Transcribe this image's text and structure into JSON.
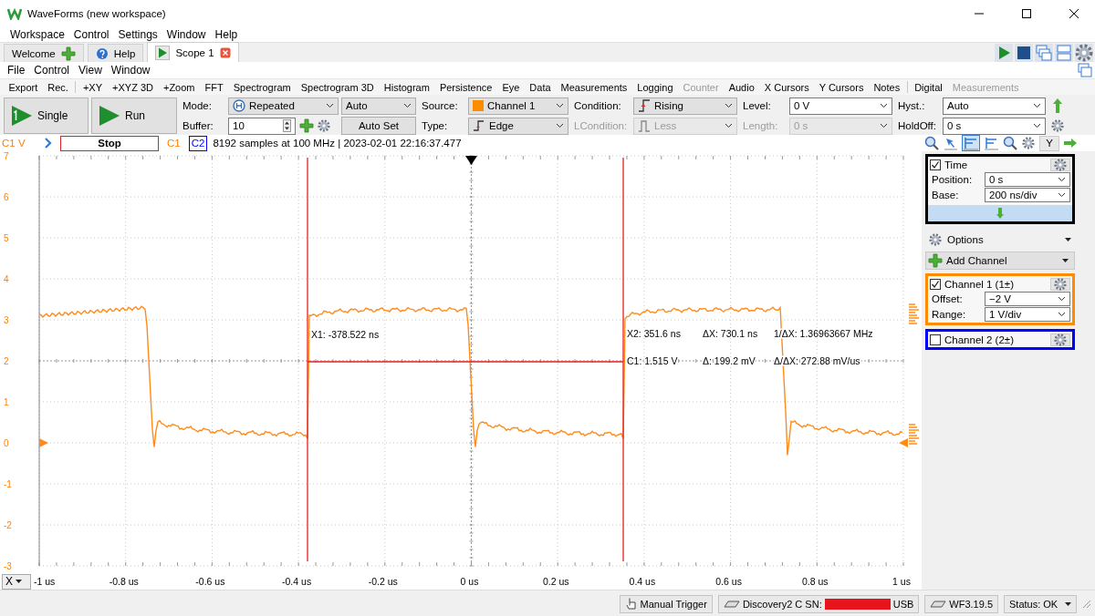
{
  "window": {
    "title": "WaveForms (new workspace)"
  },
  "menu": [
    "Workspace",
    "Control",
    "Settings",
    "Window",
    "Help"
  ],
  "tabs": [
    {
      "label": "Welcome",
      "selected": false
    },
    {
      "label": "Help",
      "selected": false
    },
    {
      "label": "Scope 1",
      "selected": true
    }
  ],
  "scope_menu": [
    "File",
    "Control",
    "View",
    "Window"
  ],
  "toolbar": [
    {
      "label": "Export",
      "disabled": false,
      "divider_before": false
    },
    {
      "label": "Rec.",
      "disabled": false,
      "divider_before": false
    },
    {
      "label": "+XY",
      "disabled": false,
      "divider_before": true
    },
    {
      "label": "+XYZ 3D",
      "disabled": false,
      "divider_before": false
    },
    {
      "label": "+Zoom",
      "disabled": false,
      "divider_before": false
    },
    {
      "label": "FFT",
      "disabled": false,
      "divider_before": false
    },
    {
      "label": "Spectrogram",
      "disabled": false,
      "divider_before": false
    },
    {
      "label": "Spectrogram 3D",
      "disabled": false,
      "divider_before": false
    },
    {
      "label": "Histogram",
      "disabled": false,
      "divider_before": false
    },
    {
      "label": "Persistence",
      "disabled": false,
      "divider_before": false
    },
    {
      "label": "Eye",
      "disabled": false,
      "divider_before": false
    },
    {
      "label": "Data",
      "disabled": false,
      "divider_before": false
    },
    {
      "label": "Measurements",
      "disabled": false,
      "divider_before": false
    },
    {
      "label": "Logging",
      "disabled": false,
      "divider_before": false
    },
    {
      "label": "Counter",
      "disabled": true,
      "divider_before": false
    },
    {
      "label": "Audio",
      "disabled": false,
      "divider_before": false
    },
    {
      "label": "X Cursors",
      "disabled": false,
      "divider_before": false
    },
    {
      "label": "Y Cursors",
      "disabled": false,
      "divider_before": false
    },
    {
      "label": "Notes",
      "disabled": false,
      "divider_before": false
    },
    {
      "label": "Digital",
      "disabled": false,
      "divider_before": true
    },
    {
      "label": "Measurements",
      "disabled": true,
      "divider_before": false
    }
  ],
  "controls": {
    "single": "Single",
    "run": "Run",
    "grid": [
      [
        {
          "kind": "label",
          "text": "Mode:",
          "disabled": false
        },
        {
          "kind": "dropdown",
          "text": "Repeated",
          "disabled": false
        },
        {
          "kind": "dropdown",
          "text": "Auto",
          "disabled": false
        },
        {
          "kind": "label",
          "text": "Source:",
          "disabled": false
        },
        {
          "kind": "dropdown",
          "text": "Channel 1",
          "disabled": false
        },
        {
          "kind": "label",
          "text": "Condition:",
          "disabled": false
        },
        {
          "kind": "dropdown",
          "text": "Rising",
          "disabled": false
        },
        {
          "kind": "label",
          "text": "Level:",
          "disabled": false
        },
        {
          "kind": "combo",
          "text": "0 V",
          "disabled": false
        },
        {
          "kind": "label",
          "text": "Hyst.:",
          "disabled": false
        },
        {
          "kind": "combo",
          "text": "Auto",
          "disabled": false
        }
      ],
      [
        {
          "kind": "label",
          "text": "Buffer:",
          "disabled": false
        },
        {
          "kind": "spinbox",
          "text": "10",
          "disabled": false
        },
        {
          "kind": "button",
          "text": "Auto Set",
          "disabled": false
        },
        {
          "kind": "label",
          "text": "Type:",
          "disabled": false
        },
        {
          "kind": "dropdown",
          "text": "Edge",
          "disabled": false
        },
        {
          "kind": "label",
          "text": "LCondition:",
          "disabled": true
        },
        {
          "kind": "dropdown",
          "text": "Less",
          "disabled": true
        },
        {
          "kind": "label",
          "text": "Length:",
          "disabled": true
        },
        {
          "kind": "combo",
          "text": "0 s",
          "disabled": true
        },
        {
          "kind": "label",
          "text": "HoldOff:",
          "disabled": false
        },
        {
          "kind": "combo",
          "text": "0 s",
          "disabled": false
        }
      ]
    ]
  },
  "status_line": {
    "axis_unit": "C1 V",
    "stop": "Stop",
    "info": "8192 samples at 100 MHz | 2023-02-01 22:16:37.477",
    "y_button": "Y",
    "channel_buttons": [
      {
        "label": "C1",
        "selected": false,
        "color": "#ff8000"
      },
      {
        "label": "C2",
        "selected": true,
        "color": "#0000ff"
      }
    ]
  },
  "plot": {
    "y_ticks": [
      "7",
      "6",
      "5",
      "4",
      "3",
      "2",
      "1",
      "0",
      "-1",
      "-2",
      "-3"
    ],
    "x_axis": "X",
    "x_ticks": [
      "-1 us",
      "-0.8 us",
      "-0.6 us",
      "-0.4 us",
      "-0.2 us",
      "0 us",
      "0.2 us",
      "0.4 us",
      "0.6 us",
      "0.8 us",
      "1 us"
    ],
    "cursor_readouts": [
      "X1: -378.522 ns",
      "X2: 351.6 ns",
      "ΔX: 730.1 ns",
      "1/ΔX: 1.36963667 MHz",
      "C1: 1.515 V",
      "Δ: 199.2 mV",
      "Δ/ΔX: 272.88 mV/us"
    ]
  },
  "time": {
    "label": "Time",
    "checked": true,
    "rows": [
      {
        "label": "Position:",
        "value": "0 s"
      },
      {
        "label": "Base:",
        "value": "200 ns/div"
      }
    ]
  },
  "options": "Options",
  "add_channel": "Add Channel",
  "channels": [
    {
      "label": "Channel 1 (1±)",
      "checked": true,
      "color": "#ff8c00",
      "rows": [
        {
          "label": "Offset:",
          "value": "−2 V"
        },
        {
          "label": "Range:",
          "value": "1 V/div"
        }
      ]
    },
    {
      "label": "Channel 2 (2±)",
      "checked": false,
      "color": "#0000ff"
    }
  ],
  "status_bar": {
    "manual_trigger": "Manual Trigger",
    "device": "Discovery2 C SN:",
    "connection": "USB",
    "version": "WF3.19.5",
    "status": "Status: OK"
  }
}
